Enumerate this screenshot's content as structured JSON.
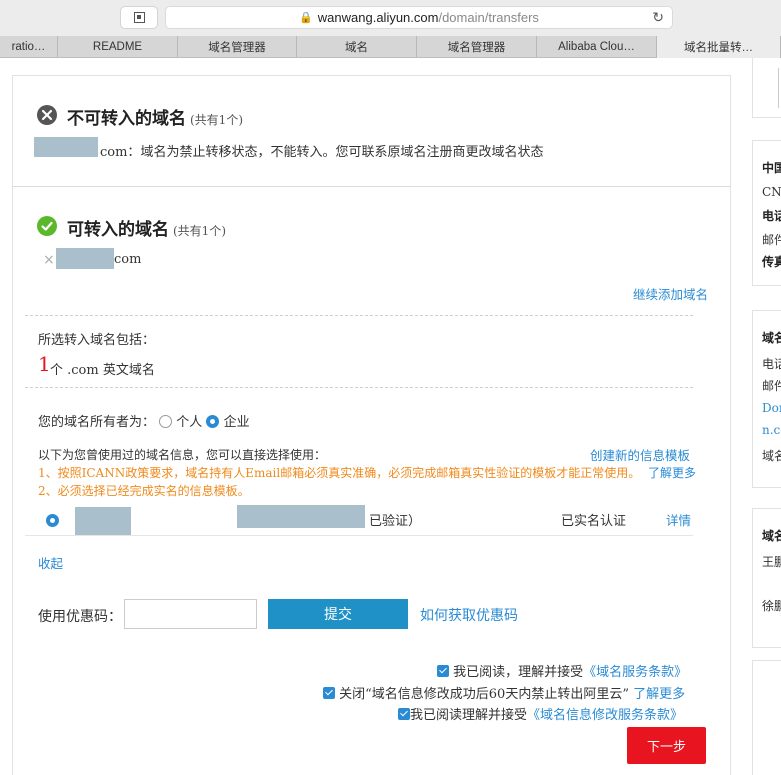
{
  "browser": {
    "url_host": "wanwang.aliyun.com",
    "url_path": "/domain/transfers",
    "tabs": [
      "ratio…",
      "README",
      "域名管理器",
      "域名",
      "域名管理器",
      "Alibaba Clou…",
      "域名批量转…"
    ]
  },
  "blocked": {
    "title": "不可转入的域名",
    "count": "(共有1个)",
    "domain_suffix": "com：",
    "message": "域名为禁止转移状态，不能转入。您可联系原域名注册商更改域名状态"
  },
  "allowed": {
    "title": "可转入的域名",
    "count": "(共有1个)",
    "domain_suffix": "com",
    "remove_icon": "×",
    "add_more": "继续添加域名"
  },
  "summary": {
    "label": "所选转入域名包括：",
    "number": "1",
    "text": "个 .com 英文域名"
  },
  "owner": {
    "label": "您的域名所有者为：",
    "options": [
      "个人",
      "企业"
    ],
    "selected": "企业"
  },
  "template": {
    "intro": "以下为您曾使用过的域名信息，您可以直接选择使用：",
    "create_link": "创建新的信息模板",
    "notice1": "1、按照ICANN政策要求，域名持有人Email邮箱必须真实准确，必须完成邮箱真实性验证的模板才能正常使用。",
    "learn_more": "了解更多",
    "notice2": "2、必须选择已经完成实名的信息模板。",
    "row_verified": "已验证）",
    "row_status": "已实名认证",
    "row_detail": "详情",
    "collapse": "收起"
  },
  "coupon": {
    "label": "使用优惠码：",
    "value": "",
    "submit": "提交",
    "how_to": "如何获取优惠码"
  },
  "agreements": {
    "a1_prefix": "我已阅读，理解并接受",
    "a1_link": "《域名服务条款》",
    "a2_prefix": "关闭“域名信息修改成功后60天内禁止转出阿里云”",
    "a2_link": "了解更多",
    "a3_prefix": "我已阅读理解并接受",
    "a3_link": "《域名信息修改服务条款》"
  },
  "next_button": "下一步",
  "sidebar": {
    "card1": [
      "中国",
      "CNI",
      "电话",
      "邮件",
      "传真"
    ],
    "card2": [
      "域名",
      "电话",
      "邮件",
      "Dor",
      "n.co",
      "域名"
    ],
    "card3": [
      "域名",
      "王鹏",
      "徐鹏"
    ]
  },
  "colors": {
    "accent": "#2a8bd4",
    "submit": "#1f91c7",
    "next": "#e8141f",
    "warning": "#f08a1c",
    "mask": "#a9c0cc"
  }
}
